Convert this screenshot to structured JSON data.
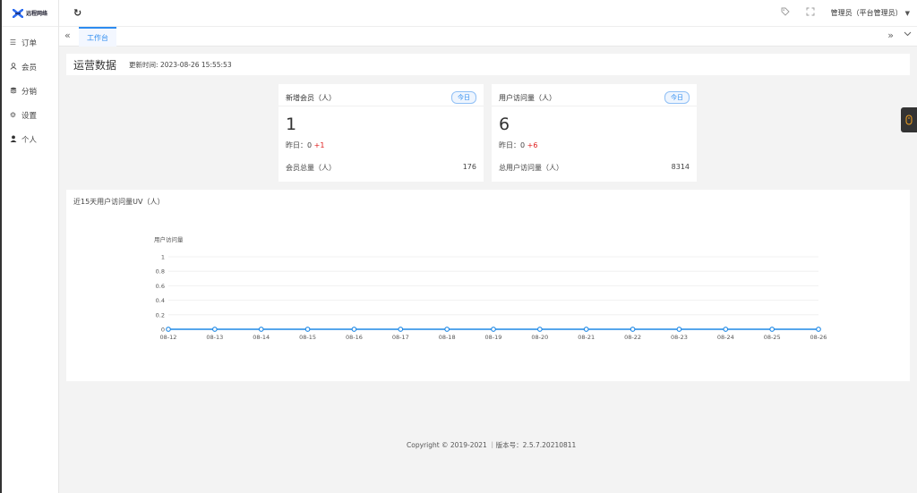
{
  "sidebar": {
    "logo_text": "远程网络",
    "items": [
      {
        "label": "订单",
        "icon": "list-icon"
      },
      {
        "label": "会员",
        "icon": "user-icon"
      },
      {
        "label": "分销",
        "icon": "stack-icon"
      },
      {
        "label": "设置",
        "icon": "gear-icon"
      },
      {
        "label": "个人",
        "icon": "person-icon"
      }
    ]
  },
  "topbar": {
    "user_label": "管理员（平台管理员）"
  },
  "tabs": [
    {
      "label": "工作台",
      "active": true
    }
  ],
  "header": {
    "title": "运营数据",
    "updated_label": "更新时间:",
    "updated_time": "2023-08-26 15:55:53"
  },
  "stats": [
    {
      "label": "新增会员（人）",
      "badge": "今日",
      "value": "1",
      "yesterday_label": "昨日：",
      "yesterday_value": "0",
      "delta": "+1",
      "total_label": "会员总量（人）",
      "total_value": "176"
    },
    {
      "label": "用户访问量（人）",
      "badge": "今日",
      "value": "6",
      "yesterday_label": "昨日：",
      "yesterday_value": "0",
      "delta": "+6",
      "total_label": "总用户访问量（人）",
      "total_value": "8314"
    }
  ],
  "chart_title": "近15天用户访问量UV（人）",
  "chart_data": {
    "type": "line",
    "ylabel": "用户访问量",
    "categories": [
      "08-12",
      "08-13",
      "08-14",
      "08-15",
      "08-16",
      "08-17",
      "08-18",
      "08-19",
      "08-20",
      "08-21",
      "08-22",
      "08-23",
      "08-24",
      "08-25",
      "08-26"
    ],
    "values": [
      0,
      0,
      0,
      0,
      0,
      0,
      0,
      0,
      0,
      0,
      0,
      0,
      0,
      0,
      0
    ],
    "yticks": [
      "0",
      "0.2",
      "0.4",
      "0.6",
      "0.8",
      "1"
    ],
    "ylim": [
      0,
      1
    ],
    "color": "#1e88e5",
    "grid": true
  },
  "footer": "Copyright © 2019-2021 ｜版本号：2.5.7.20210811"
}
